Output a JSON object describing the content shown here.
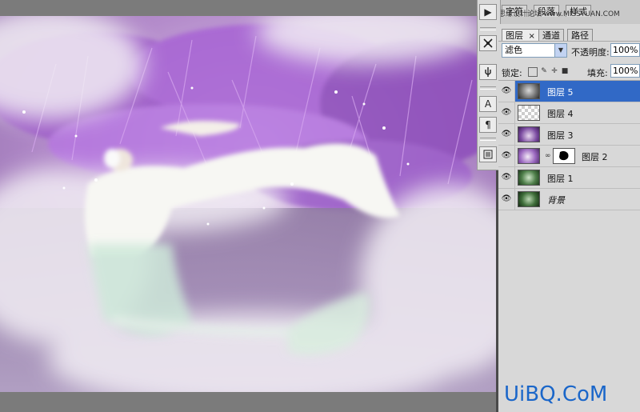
{
  "window_tabs": [
    {
      "label": "字符"
    },
    {
      "label": "段落"
    },
    {
      "label": "样式"
    }
  ],
  "top_watermark": "思缘设计论坛 www.MISSYUAN.COM",
  "panel_tabs": [
    {
      "label": "图层",
      "close": "×",
      "active": true
    },
    {
      "label": "通道",
      "active": false
    },
    {
      "label": "路径",
      "active": false
    }
  ],
  "blend_mode": "滤色",
  "opacity": {
    "label": "不透明度:",
    "value": "100%"
  },
  "lock": {
    "label": "锁定:"
  },
  "fill": {
    "label": "填充:",
    "value": "100%"
  },
  "layers": [
    {
      "name": "图层 5",
      "selected": true,
      "thumb": "smoke",
      "mask": false
    },
    {
      "name": "图层 4",
      "selected": false,
      "thumb": "transparent",
      "mask": false
    },
    {
      "name": "图层 3",
      "selected": false,
      "thumb": "purple",
      "mask": false
    },
    {
      "name": "图层 2",
      "selected": false,
      "thumb": "purple-girl",
      "mask": true
    },
    {
      "name": "图层 1",
      "selected": false,
      "thumb": "green",
      "mask": false
    },
    {
      "name": "背景",
      "selected": false,
      "thumb": "green-dark",
      "mask": false,
      "italic": true
    }
  ],
  "tool_icons": [
    "play-icon",
    "brush-settings-icon",
    "clone-source-icon",
    "character-icon",
    "paragraph-icon",
    "layer-comps-icon"
  ],
  "tool_glyphs": {
    "play": "▶",
    "character": "A",
    "paragraph": "¶"
  },
  "eye_glyph": "👁",
  "watermark": "UiBQ.CoM",
  "colors": {
    "selection": "#3169c6",
    "watermark": "#1a66c9"
  }
}
